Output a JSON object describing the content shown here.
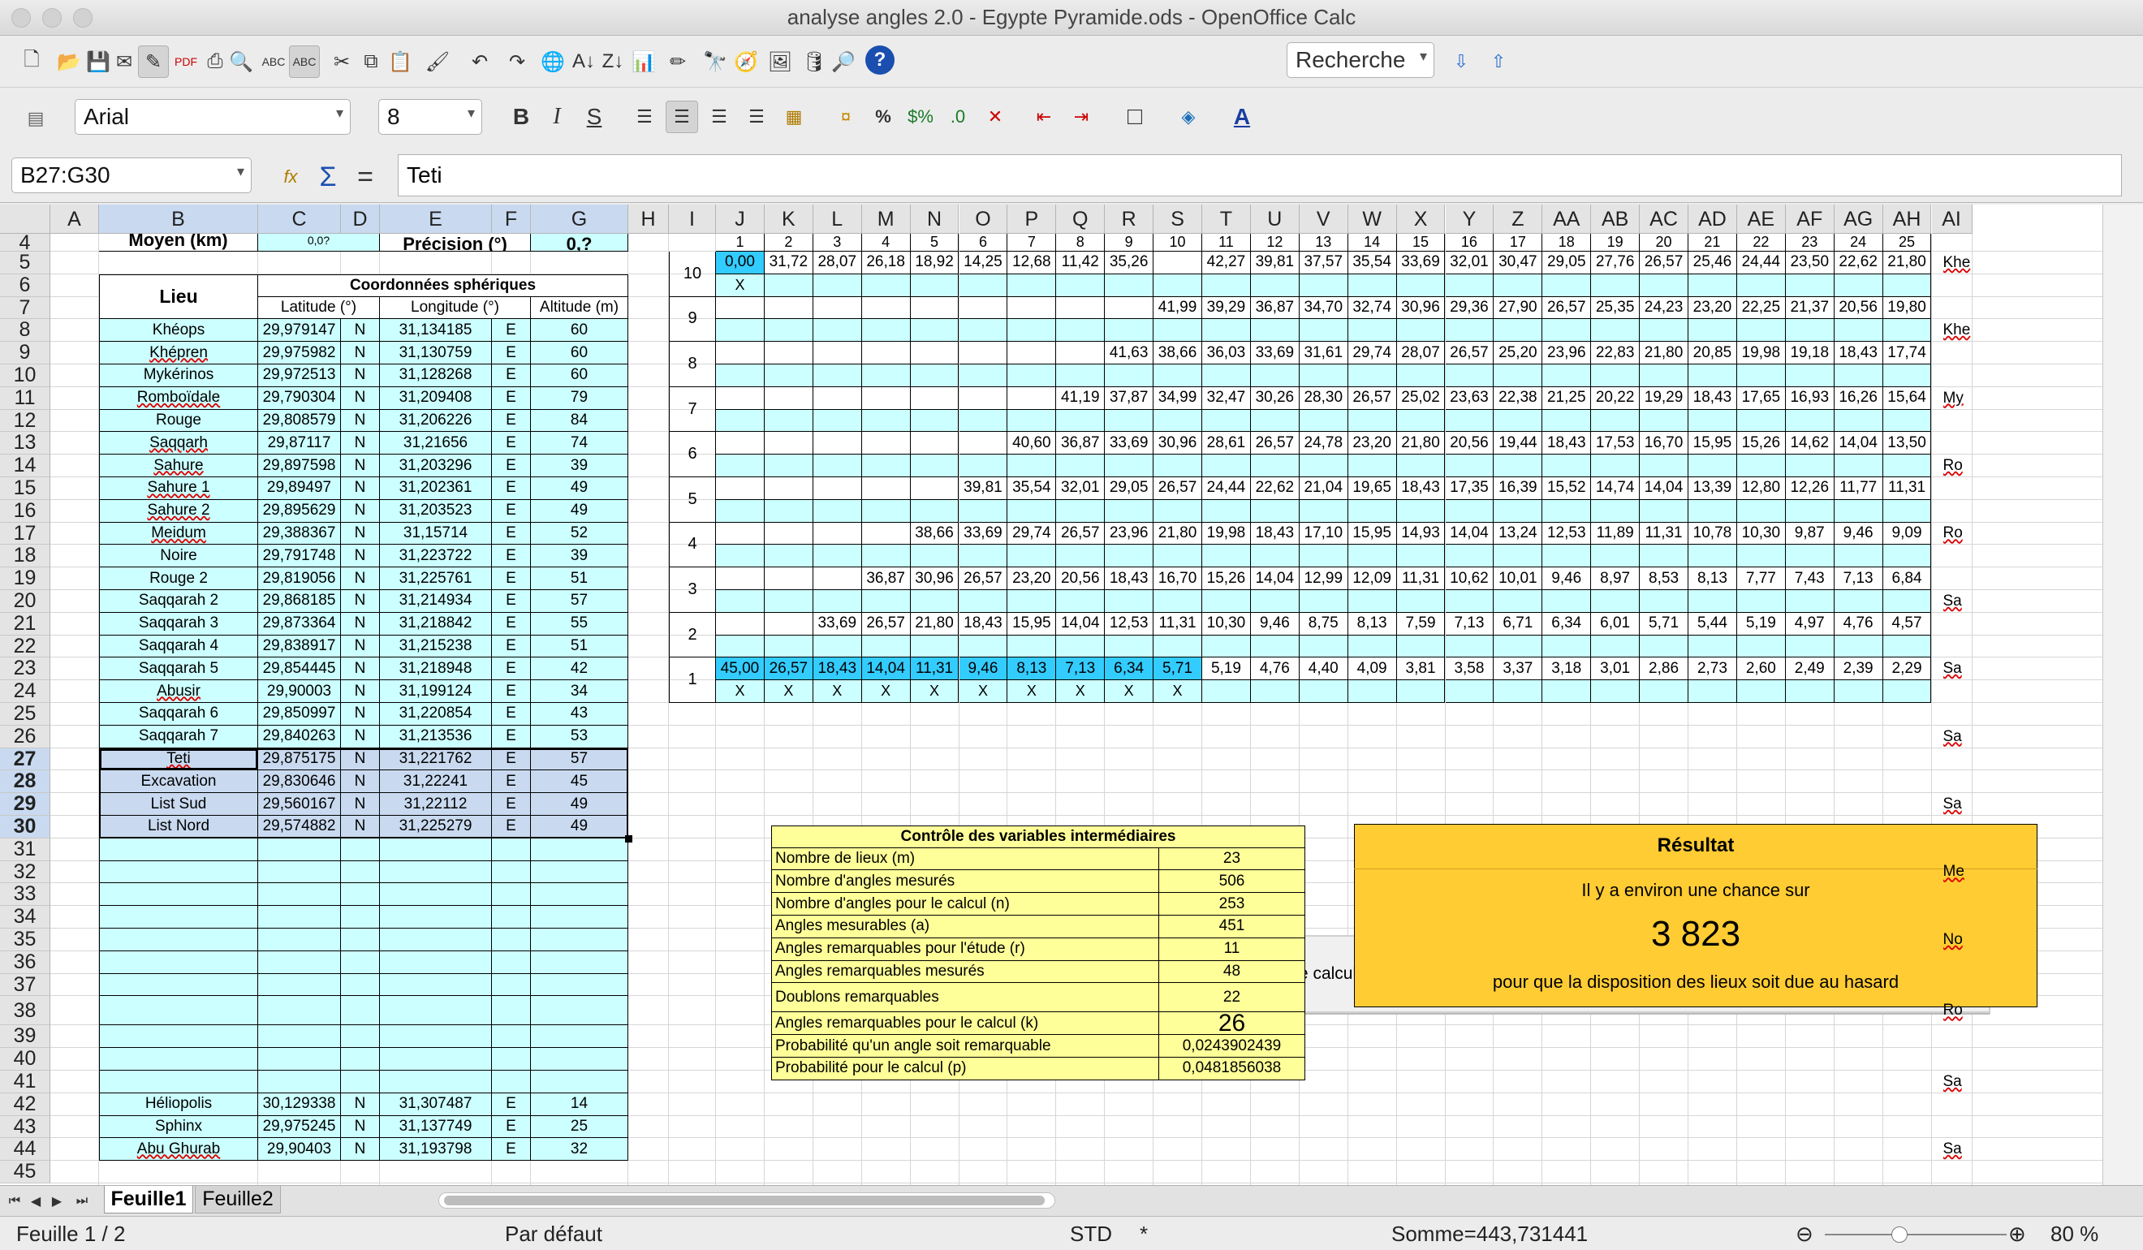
{
  "window": {
    "title": "analyse angles 2.0 - Egypte Pyramide.ods - OpenOffice Calc"
  },
  "toolbar": {
    "search_placeholder": "Recherche",
    "font_name": "Arial",
    "font_size": "8"
  },
  "icons": [
    "new-document-icon",
    "open-folder-icon",
    "save-icon",
    "email-icon",
    "edit-mode-icon",
    "export-pdf-icon",
    "print-icon",
    "page-preview-icon",
    "spellcheck-icon",
    "autospell-icon",
    "cut-icon",
    "copy-icon",
    "paste-icon",
    "format-paintbrush-icon",
    "undo-icon",
    "redo-icon",
    "hyperlink-icon",
    "sort-ascending-icon",
    "sort-descending-icon",
    "chart-icon",
    "draw-functions-icon",
    "find-replace-icon",
    "navigator-icon",
    "gallery-icon",
    "data-sources-icon",
    "zoom-icon",
    "help-icon"
  ],
  "formula": {
    "cell_ref": "B27:G30",
    "content": "Teti"
  },
  "columns": [
    "A",
    "B",
    "C",
    "D",
    "E",
    "F",
    "G",
    "H",
    "I",
    "J",
    "K",
    "L",
    "M",
    "N",
    "O",
    "P",
    "Q",
    "R",
    "S",
    "T",
    "U",
    "V",
    "W",
    "X",
    "Y",
    "Z",
    "AA",
    "AB",
    "AC",
    "AD",
    "AE",
    "AF",
    "AG",
    "AH",
    "AI"
  ],
  "rows": [
    "4",
    "5",
    "6",
    "7",
    "8",
    "9",
    "10",
    "11",
    "12",
    "13",
    "14",
    "15",
    "16",
    "17",
    "18",
    "19",
    "20",
    "21",
    "22",
    "23",
    "24",
    "25",
    "26",
    "27",
    "28",
    "29",
    "30",
    "31",
    "32",
    "33",
    "34",
    "35",
    "36",
    "37",
    "38",
    "39",
    "40",
    "41",
    "42",
    "43",
    "44",
    "45"
  ],
  "table": {
    "row4_label": "Moyen (km)",
    "row4_c": "0,0?",
    "row4_e": "Précision (°)",
    "row4_g": "0,?",
    "head_lieu": "Lieu",
    "head_coord": "Coordonnées sphériques",
    "head_lat": "Latitude (°)",
    "head_lon": "Longitude (°)",
    "head_alt": "Altitude (m)",
    "places": [
      [
        "Khéops",
        "29,979147",
        "N",
        "31,134185",
        "E",
        "60"
      ],
      [
        "Khépren",
        "29,975982",
        "N",
        "31,130759",
        "E",
        "60"
      ],
      [
        "Mykérinos",
        "29,972513",
        "N",
        "31,128268",
        "E",
        "60"
      ],
      [
        "Romboïdale",
        "29,790304",
        "N",
        "31,209408",
        "E",
        "79"
      ],
      [
        "Rouge",
        "29,808579",
        "N",
        "31,206226",
        "E",
        "84"
      ],
      [
        "Saqqarh",
        "29,87117",
        "N",
        "31,21656",
        "E",
        "74"
      ],
      [
        "Sahure",
        "29,897598",
        "N",
        "31,203296",
        "E",
        "39"
      ],
      [
        "Sahure 1",
        "29,89497",
        "N",
        "31,202361",
        "E",
        "49"
      ],
      [
        "Sahure 2",
        "29,895629",
        "N",
        "31,203523",
        "E",
        "49"
      ],
      [
        "Meidum",
        "29,388367",
        "N",
        "31,15714",
        "E",
        "52"
      ],
      [
        "Noire",
        "29,791748",
        "N",
        "31,223722",
        "E",
        "39"
      ],
      [
        "Rouge 2",
        "29,819056",
        "N",
        "31,225761",
        "E",
        "51"
      ],
      [
        "Saqqarah 2",
        "29,868185",
        "N",
        "31,214934",
        "E",
        "57"
      ],
      [
        "Saqqarah 3",
        "29,873364",
        "N",
        "31,218842",
        "E",
        "55"
      ],
      [
        "Saqqarah 4",
        "29,838917",
        "N",
        "31,215238",
        "E",
        "51"
      ],
      [
        "Saqqarah 5",
        "29,854445",
        "N",
        "31,218948",
        "E",
        "42"
      ],
      [
        "Abusir",
        "29,90003",
        "N",
        "31,199124",
        "E",
        "34"
      ],
      [
        "Saqqarah 6",
        "29,850997",
        "N",
        "31,220854",
        "E",
        "43"
      ],
      [
        "Saqqarah 7",
        "29,840263",
        "N",
        "31,213536",
        "E",
        "53"
      ],
      [
        "Teti",
        "29,875175",
        "N",
        "31,221762",
        "E",
        "57"
      ],
      [
        "Excavation",
        "29,830646",
        "N",
        "31,22241",
        "E",
        "45"
      ],
      [
        "List Sud",
        "29,560167",
        "N",
        "31,22112",
        "E",
        "49"
      ],
      [
        "List Nord",
        "29,574882",
        "N",
        "31,225279",
        "E",
        "49"
      ]
    ],
    "places2": [
      [
        "Héliopolis",
        "30,129338",
        "N",
        "31,307487",
        "E",
        "14"
      ],
      [
        "Sphinx",
        "29,975245",
        "N",
        "31,137749",
        "E",
        "25"
      ],
      [
        "Abu Ghurab",
        "29,90403",
        "N",
        "31,193798",
        "E",
        "32"
      ]
    ]
  },
  "matrix": {
    "col_nums": [
      "1",
      "2",
      "3",
      "4",
      "5",
      "6",
      "7",
      "8",
      "9",
      "10",
      "11",
      "12",
      "13",
      "14",
      "15",
      "16",
      "17",
      "18",
      "19",
      "20",
      "21",
      "22",
      "23",
      "24",
      "25"
    ],
    "row_labels": [
      "10",
      "9",
      "8",
      "7",
      "6",
      "5",
      "4",
      "3",
      "2",
      "1"
    ],
    "rows": [
      [
        "0,00",
        "31,72",
        "28,07",
        "26,18",
        "18,92",
        "14,25",
        "12,68",
        "11,42",
        "35,26",
        "",
        "42,27",
        "39,81",
        "37,57",
        "35,54",
        "33,69",
        "32,01",
        "30,47",
        "29,05",
        "27,76",
        "26,57",
        "25,46",
        "24,44",
        "23,50",
        "22,62",
        "21,80"
      ],
      [
        "",
        "",
        "",
        "",
        "",
        "",
        "",
        "",
        "",
        "41,99",
        "39,29",
        "36,87",
        "34,70",
        "32,74",
        "30,96",
        "29,36",
        "27,90",
        "26,57",
        "25,35",
        "24,23",
        "23,20",
        "22,25",
        "21,37",
        "20,56",
        "19,80"
      ],
      [
        "",
        "",
        "",
        "",
        "",
        "",
        "",
        "",
        "41,63",
        "38,66",
        "36,03",
        "33,69",
        "31,61",
        "29,74",
        "28,07",
        "26,57",
        "25,20",
        "23,96",
        "22,83",
        "21,80",
        "20,85",
        "19,98",
        "19,18",
        "18,43",
        "17,74"
      ],
      [
        "",
        "",
        "",
        "",
        "",
        "",
        "",
        "41,19",
        "37,87",
        "34,99",
        "32,47",
        "30,26",
        "28,30",
        "26,57",
        "25,02",
        "23,63",
        "22,38",
        "21,25",
        "20,22",
        "19,29",
        "18,43",
        "17,65",
        "16,93",
        "16,26",
        "15,64"
      ],
      [
        "",
        "",
        "",
        "",
        "",
        "",
        "40,60",
        "36,87",
        "33,69",
        "30,96",
        "28,61",
        "26,57",
        "24,78",
        "23,20",
        "21,80",
        "20,56",
        "19,44",
        "18,43",
        "17,53",
        "16,70",
        "15,95",
        "15,26",
        "14,62",
        "14,04",
        "13,50"
      ],
      [
        "",
        "",
        "",
        "",
        "",
        "39,81",
        "35,54",
        "32,01",
        "29,05",
        "26,57",
        "24,44",
        "22,62",
        "21,04",
        "19,65",
        "18,43",
        "17,35",
        "16,39",
        "15,52",
        "14,74",
        "14,04",
        "13,39",
        "12,80",
        "12,26",
        "11,77",
        "11,31"
      ],
      [
        "",
        "",
        "",
        "",
        "38,66",
        "33,69",
        "29,74",
        "26,57",
        "23,96",
        "21,80",
        "19,98",
        "18,43",
        "17,10",
        "15,95",
        "14,93",
        "14,04",
        "13,24",
        "12,53",
        "11,89",
        "11,31",
        "10,78",
        "10,30",
        "9,87",
        "9,46",
        "9,09"
      ],
      [
        "",
        "",
        "",
        "36,87",
        "30,96",
        "26,57",
        "23,20",
        "20,56",
        "18,43",
        "16,70",
        "15,26",
        "14,04",
        "12,99",
        "12,09",
        "11,31",
        "10,62",
        "10,01",
        "9,46",
        "8,97",
        "8,53",
        "8,13",
        "7,77",
        "7,43",
        "7,13",
        "6,84"
      ],
      [
        "",
        "",
        "33,69",
        "26,57",
        "21,80",
        "18,43",
        "15,95",
        "14,04",
        "12,53",
        "11,31",
        "10,30",
        "9,46",
        "8,75",
        "8,13",
        "7,59",
        "7,13",
        "6,71",
        "6,34",
        "6,01",
        "5,71",
        "5,44",
        "5,19",
        "4,97",
        "4,76",
        "4,57"
      ],
      [
        "45,00",
        "26,57",
        "18,43",
        "14,04",
        "11,31",
        "9,46",
        "8,13",
        "7,13",
        "6,34",
        "5,71",
        "5,19",
        "4,76",
        "4,40",
        "4,09",
        "3,81",
        "3,58",
        "3,37",
        "3,18",
        "3,01",
        "2,86",
        "2,73",
        "2,60",
        "2,49",
        "2,39",
        "2,29"
      ]
    ],
    "mark": "X"
  },
  "button": {
    "label": "Lancer le calcul et l'analyse des angles"
  },
  "control": {
    "title": "Contrôle des variables intermédiaires",
    "rows": [
      [
        "Nombre de lieux (m)",
        "23"
      ],
      [
        "Nombre d'angles mesurés",
        "506"
      ],
      [
        "Nombre d'angles pour le calcul (n)",
        "253"
      ],
      [
        "Angles mesurables (a)",
        "451"
      ],
      [
        "Angles remarquables pour l'étude (r)",
        "11"
      ],
      [
        "Angles remarquables mesurés",
        "48"
      ],
      [
        "Doublons remarquables",
        "22"
      ],
      [
        "Angles remarquables pour le calcul (k)",
        "26"
      ],
      [
        "Probabilité qu'un angle soit remarquable",
        "0,0243902439"
      ],
      [
        "Probabilité pour le calcul (p)",
        "0,0481856038"
      ]
    ]
  },
  "result": {
    "title": "Résultat",
    "line1": "Il y a environ une chance sur",
    "value": "3 823",
    "line2": "pour que la disposition des lieux soit due au hasard"
  },
  "right_col": [
    "Khe",
    "Khe",
    "My",
    "Ro",
    "Ro",
    "Sa",
    "Sa",
    "Sa",
    "Sa",
    "Me",
    "No",
    "Ro",
    "Sa",
    "Sa"
  ],
  "tabs": [
    "Feuille1",
    "Feuille2"
  ],
  "status": {
    "sheet": "Feuille 1 / 2",
    "style": "Par défaut",
    "mode": "STD",
    "modified": "*",
    "sum": "Somme=443,731441",
    "zoom": "80 %"
  },
  "colors": {
    "cyan": "#ccffff",
    "cyan_dark": "#33ccff",
    "yellow": "#ffff99",
    "orange": "#ffcc33",
    "selection": "#c9daf0"
  }
}
